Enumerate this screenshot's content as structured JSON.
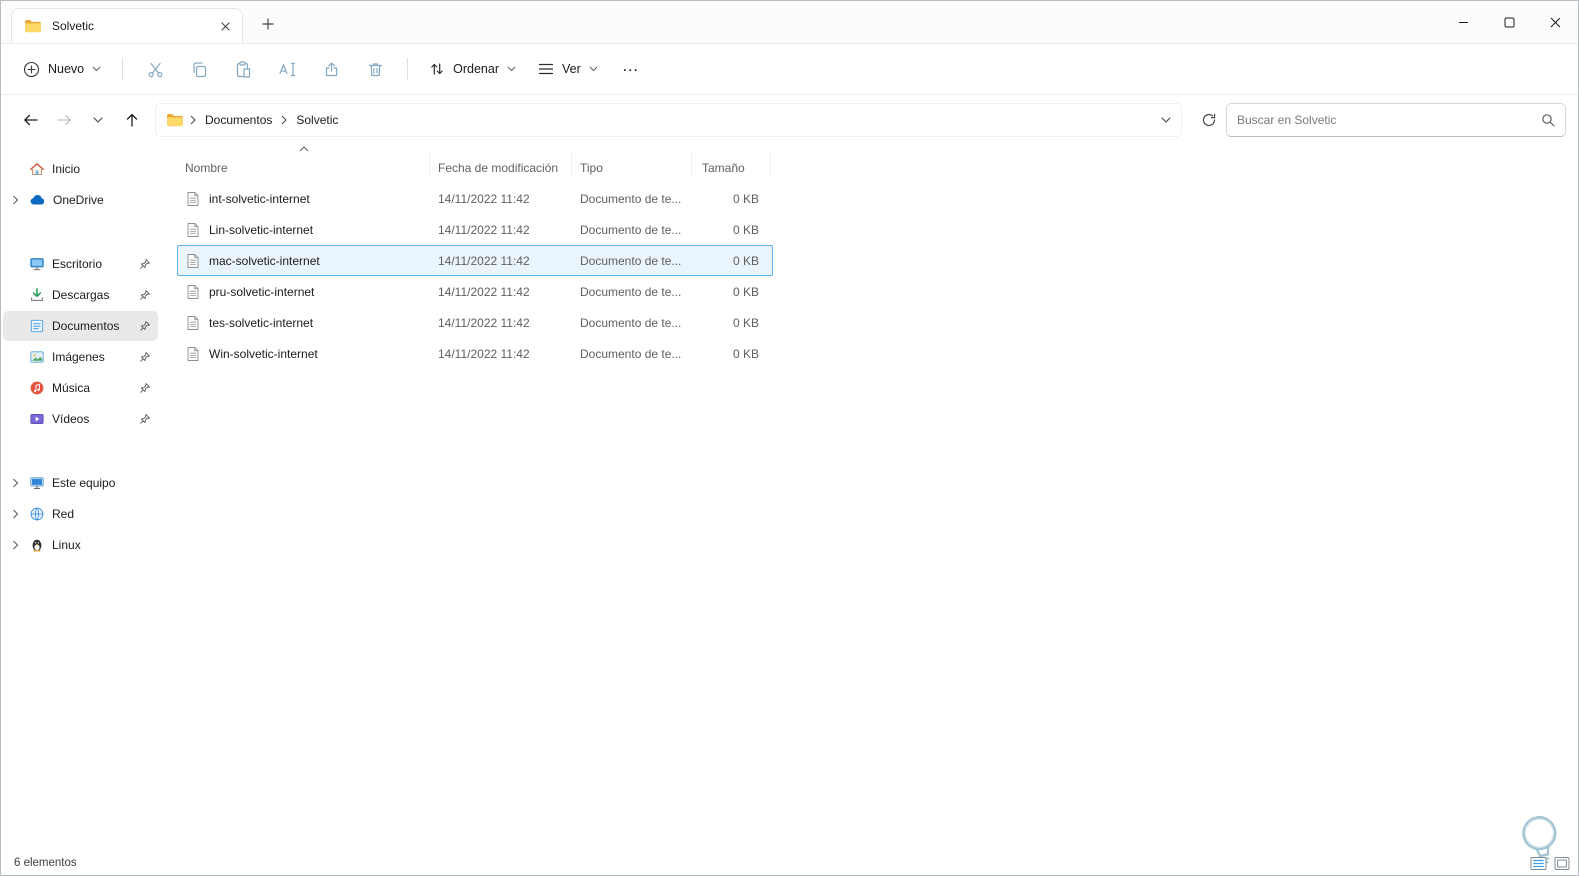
{
  "window": {
    "tab_title": "Solvetic"
  },
  "toolbar": {
    "new_label": "Nuevo",
    "sort_label": "Ordenar",
    "view_label": "Ver",
    "more_label": "…"
  },
  "navbar": {
    "crumbs": [
      "Documentos",
      "Solvetic"
    ],
    "search_placeholder": "Buscar en Solvetic"
  },
  "sidebar": {
    "items": [
      {
        "label": "Inicio",
        "pinned": false
      },
      {
        "label": "OneDrive",
        "pinned": false
      },
      {
        "label": "Escritorio",
        "pinned": true
      },
      {
        "label": "Descargas",
        "pinned": true
      },
      {
        "label": "Documentos",
        "pinned": true,
        "selected": true
      },
      {
        "label": "Imágenes",
        "pinned": true
      },
      {
        "label": "Música",
        "pinned": true
      },
      {
        "label": "Vídeos",
        "pinned": true
      },
      {
        "label": "Este equipo",
        "pinned": false
      },
      {
        "label": "Red",
        "pinned": false
      },
      {
        "label": "Linux",
        "pinned": false
      }
    ]
  },
  "files": {
    "columns": [
      "Nombre",
      "Fecha de modificación",
      "Tipo",
      "Tamaño"
    ],
    "rows": [
      {
        "name": "int-solvetic-internet",
        "modified": "14/11/2022 11:42",
        "type": "Documento de te...",
        "size": "0 KB"
      },
      {
        "name": "Lin-solvetic-internet",
        "modified": "14/11/2022 11:42",
        "type": "Documento de te...",
        "size": "0 KB"
      },
      {
        "name": "mac-solvetic-internet",
        "modified": "14/11/2022 11:42",
        "type": "Documento de te...",
        "size": "0 KB",
        "selected": true
      },
      {
        "name": "pru-solvetic-internet",
        "modified": "14/11/2022 11:42",
        "type": "Documento de te...",
        "size": "0 KB"
      },
      {
        "name": "tes-solvetic-internet",
        "modified": "14/11/2022 11:42",
        "type": "Documento de te...",
        "size": "0 KB"
      },
      {
        "name": "Win-solvetic-internet",
        "modified": "14/11/2022 11:42",
        "type": "Documento de te...",
        "size": "0 KB"
      }
    ]
  },
  "statusbar": {
    "count": "6 elementos"
  },
  "colors": {
    "selection_border": "#5fb2e8",
    "selection_bg": "#e9f4fc",
    "sidebar_selected_bg": "#e9e9e9",
    "folder_yellow": "#fed96a",
    "onedrive_blue": "#0b68c3",
    "downloads_green": "#1f9d55"
  }
}
